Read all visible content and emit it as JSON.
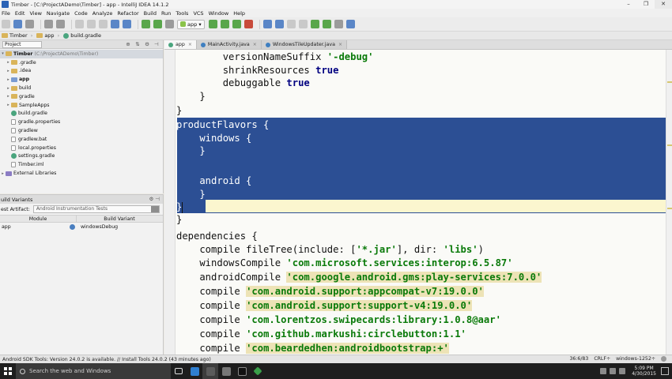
{
  "window": {
    "title": "Timber - [C:\\ProjectADemo\\Timber] - app - IntelliJ IDEA 14.1.2",
    "controls": [
      "–",
      "❐",
      "✕"
    ]
  },
  "menu": [
    "File",
    "Edit",
    "View",
    "Navigate",
    "Code",
    "Analyze",
    "Refactor",
    "Build",
    "Run",
    "Tools",
    "VCS",
    "Window",
    "Help"
  ],
  "toolbar": {
    "run_config": "app"
  },
  "breadcrumbs": [
    "Timber",
    "app",
    "build.gradle"
  ],
  "project_panel": {
    "selector": "Project",
    "tools": [
      "⊕",
      "⇅",
      "⚙",
      "⊣"
    ],
    "root": {
      "label": "Timber",
      "path": "(C:\\ProjectADemo\\Timber)"
    },
    "items": [
      {
        "label": ".gradle",
        "kind": "folder",
        "expandable": true,
        "bold": false
      },
      {
        "label": ".idea",
        "kind": "folder",
        "expandable": true,
        "bold": false
      },
      {
        "label": "app",
        "kind": "folder-blue",
        "expandable": true,
        "bold": true
      },
      {
        "label": "build",
        "kind": "folder",
        "expandable": true,
        "bold": false
      },
      {
        "label": "gradle",
        "kind": "folder",
        "expandable": true,
        "bold": false
      },
      {
        "label": "SampleApps",
        "kind": "folder",
        "expandable": true,
        "bold": false
      },
      {
        "label": "build.gradle",
        "kind": "gradle",
        "expandable": false,
        "bold": false
      },
      {
        "label": "gradle.properties",
        "kind": "file",
        "expandable": false,
        "bold": false
      },
      {
        "label": "gradlew",
        "kind": "file",
        "expandable": false,
        "bold": false
      },
      {
        "label": "gradlew.bat",
        "kind": "file",
        "expandable": false,
        "bold": false
      },
      {
        "label": "local.properties",
        "kind": "file",
        "expandable": false,
        "bold": false
      },
      {
        "label": "settings.gradle",
        "kind": "gradle",
        "expandable": false,
        "bold": false
      },
      {
        "label": "Timber.iml",
        "kind": "file",
        "expandable": false,
        "bold": false
      }
    ],
    "external_libraries": "External Libraries"
  },
  "build_variants": {
    "title": "uild Variants",
    "tools": "⚙ ⊣",
    "test_artifact_label": "est Artifact:",
    "test_artifact_value": "Android Instrumentation Tests",
    "columns": [
      "Module",
      "Build Variant"
    ],
    "rows": [
      {
        "module": "app",
        "variant": "windowsDebug"
      }
    ]
  },
  "editor_tabs": [
    {
      "label": "app",
      "icon": "gradle",
      "active": true
    },
    {
      "label": "MainActivity.java",
      "icon": "java",
      "active": false
    },
    {
      "label": "WindowsTileUpdater.java",
      "icon": "java",
      "active": false
    }
  ],
  "code_lines": [
    {
      "text": "        versionNameSuffix '-debug'"
    },
    {
      "text": "        shrinkResources true"
    },
    {
      "text": "        debuggable true"
    },
    {
      "text": "    }"
    },
    {
      "text": "}"
    },
    {
      "text": "productFlavors {"
    },
    {
      "text": "    windows {"
    },
    {
      "text": "    }"
    },
    {
      "text": ""
    },
    {
      "text": "    android {"
    },
    {
      "text": "    }"
    },
    {
      "text": "}"
    },
    {
      "text": "}"
    },
    {
      "text": "dependencies {"
    },
    {
      "text": "    compile fileTree(include: ['*.jar'], dir: 'libs')"
    },
    {
      "text": "    windowsCompile 'com.microsoft.services:interop:6.5.87'"
    },
    {
      "text": "    androidCompile 'com.google.android.gms:play-services:7.0.0'"
    },
    {
      "text": "    compile 'com.android.support:appcompat-v7:19.0.0'"
    },
    {
      "text": "    compile 'com.android.support:support-v4:19.0.0'"
    },
    {
      "text": "    compile 'com.lorentzos.swipecards:library:1.0.8@aar'"
    },
    {
      "text": "    compile 'com.github.markushi:circlebutton:1.1'"
    },
    {
      "text": "    compile 'com.beardedhen:androidbootstrap:+'"
    }
  ],
  "status_bar": {
    "message": "Android SDK Tools: Version 24.0.2 is available. // Install Tools 24.0.2 (43 minutes ago)",
    "position": "36:6/83",
    "line_sep": "CRLF÷",
    "encoding": "windows-1252÷"
  },
  "taskbar": {
    "search_placeholder": "Search the web and Windows",
    "time": "5:09 PM",
    "date": "4/30/2015"
  },
  "colors": {
    "selection": "#2c4f94",
    "string": "#0a7a0a",
    "keyword": "#000080",
    "string_highlight": "#ede3b6"
  }
}
